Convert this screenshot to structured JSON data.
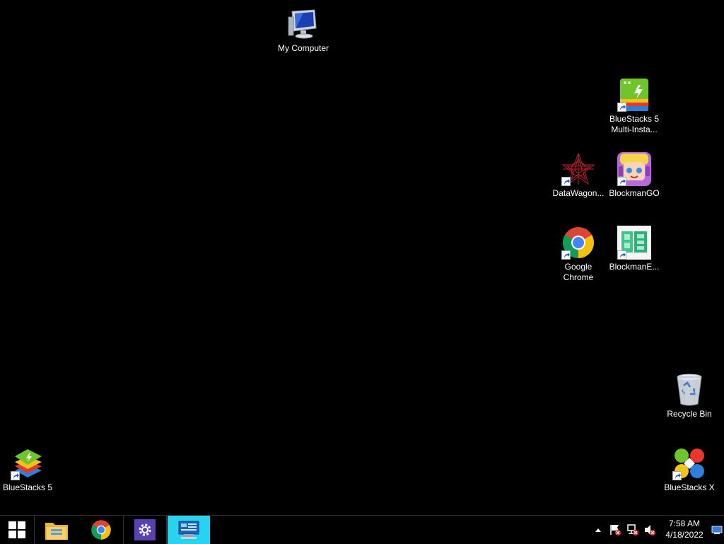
{
  "desktop": {
    "icons": {
      "my_computer": "My Computer",
      "bluestacks_multi": "BlueStacks 5\nMulti-Insta...",
      "datawagon": "DataWagon...",
      "blockmango": "BlockmanGO",
      "google_chrome": "Google\nChrome",
      "blockmane": "BlockmanE...",
      "recycle_bin": "Recycle Bin",
      "bluestacks5": "BlueStacks 5",
      "bluestacksx": "BlueStacks X"
    }
  },
  "taskbar": {
    "time": "7:58 AM",
    "date": "4/18/2022",
    "pinned": [
      "start-icon",
      "file-explorer-icon",
      "chrome-icon",
      "settings-icon",
      "server-manager-icon"
    ],
    "active_color": "#29d3f0"
  }
}
